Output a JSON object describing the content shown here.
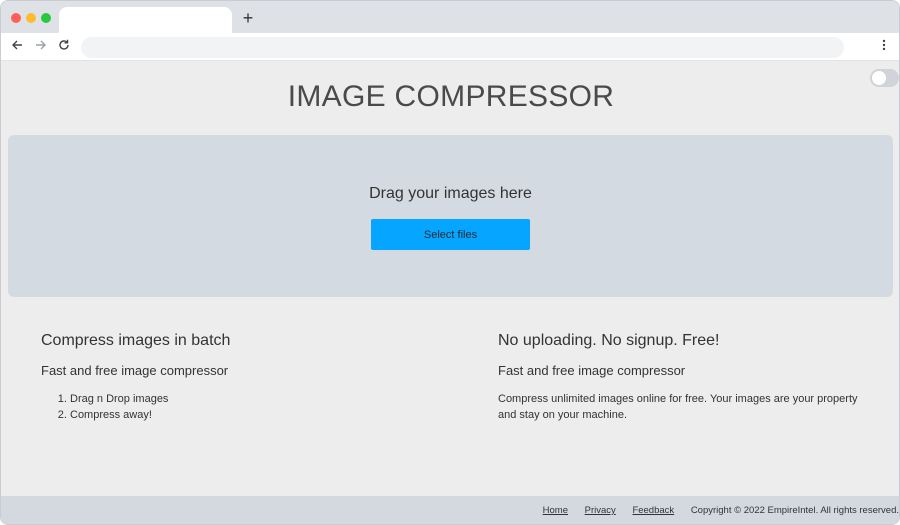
{
  "browser": {
    "new_tab_label": "+",
    "icons": {
      "back": "arrow-left-icon",
      "forward": "arrow-right-icon",
      "reload": "reload-icon",
      "menu": "kebab-menu-icon"
    },
    "omnibox_value": ""
  },
  "page": {
    "title": "IMAGE COMPRESSOR",
    "dropzone": {
      "text": "Drag your images here",
      "button_label": "Select files",
      "button_color": "#06a5ff"
    },
    "features": [
      {
        "heading": "Compress images in batch",
        "subheading": "Fast and free image compressor",
        "steps": [
          "Drag n Drop images",
          "Compress away!"
        ]
      },
      {
        "heading": "No uploading. No signup. Free!",
        "subheading": "Fast and free image compressor",
        "description": "Compress unlimited images online for free. Your images are your property and stay on your machine."
      }
    ],
    "footer": {
      "links": [
        "Home",
        "Privacy",
        "Feedback"
      ],
      "copyright": "Copyright © 2022 EmpireIntel. All rights reserved."
    }
  }
}
